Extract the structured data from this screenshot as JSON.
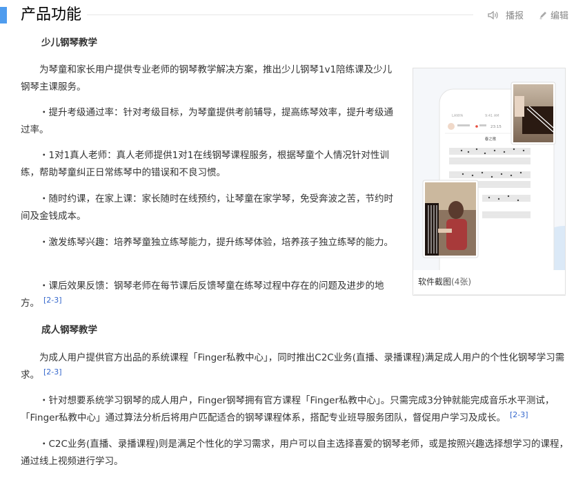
{
  "section": {
    "title": "产品功能",
    "audio_label": "播报",
    "edit_label": "编辑"
  },
  "children": {
    "title": "少儿钢琴教学",
    "intro": "为琴童和家长用户提供专业老师的钢琴教学解决方案，推出少儿钢琴1v1陪练课及少儿钢琴主课服务。",
    "bullets": [
      "・提升考级通过率：针对考级目标，为琴童提供考前辅导，提高练琴效率，提升考级通过率。",
      "・1对1真人老师：真人老师提供1对1在线钢琴课程服务，根据琴童个人情况针对性训练，帮助琴童纠正日常练琴中的错误和不良习惯。",
      "・随时约课，在家上课：家长随时在线预约，让琴童在家学琴，免受奔波之苦，节约时间及金钱成本。",
      "・激发练琴兴趣：培养琴童独立练琴能力，提升练琴体验，培养孩子独立练琴的能力。",
      "・课后效果反馈：钢琴老师在每节课后反馈琴童在练琴过程中存在的问题及进步的地方。"
    ],
    "last_ref": "[2-3]"
  },
  "adult": {
    "title": "成人钢琴教学",
    "intro": "为成人用户提供官方出品的系统课程「Finger私教中心」，同时推出C2C业务(直播、录播课程)满足成人用户的个性化钢琴学习需求。",
    "intro_ref": "[2-3]",
    "bullets": [
      "・针对想要系统学习钢琴的成人用户，Finger钢琴拥有官方课程「Finger私教中心」。只需完成3分钟就能完成音乐水平测试，「Finger私教中心」通过算法分析后将用户匹配适合的钢琴课程体系，搭配专业班导服务团队，督促用户学习及成长。",
      "・C2C业务(直播、录播课程)则是满足个性化的学习需求，用户可以自主选择喜爱的钢琴老师，或是按照兴趣选择想学习的课程，通过线上视频进行学习。"
    ],
    "bullet1_ref": "[2-3]"
  },
  "album": {
    "caption": "软件截图",
    "count": "(4张)",
    "phone": {
      "status_left": "LANYA",
      "status_time": "9:41 AM",
      "timer": "23:15",
      "screen_title": "春之歌"
    }
  },
  "colors": {
    "accent": "#4f9cee",
    "link": "#3366cc",
    "text": "#333333"
  }
}
